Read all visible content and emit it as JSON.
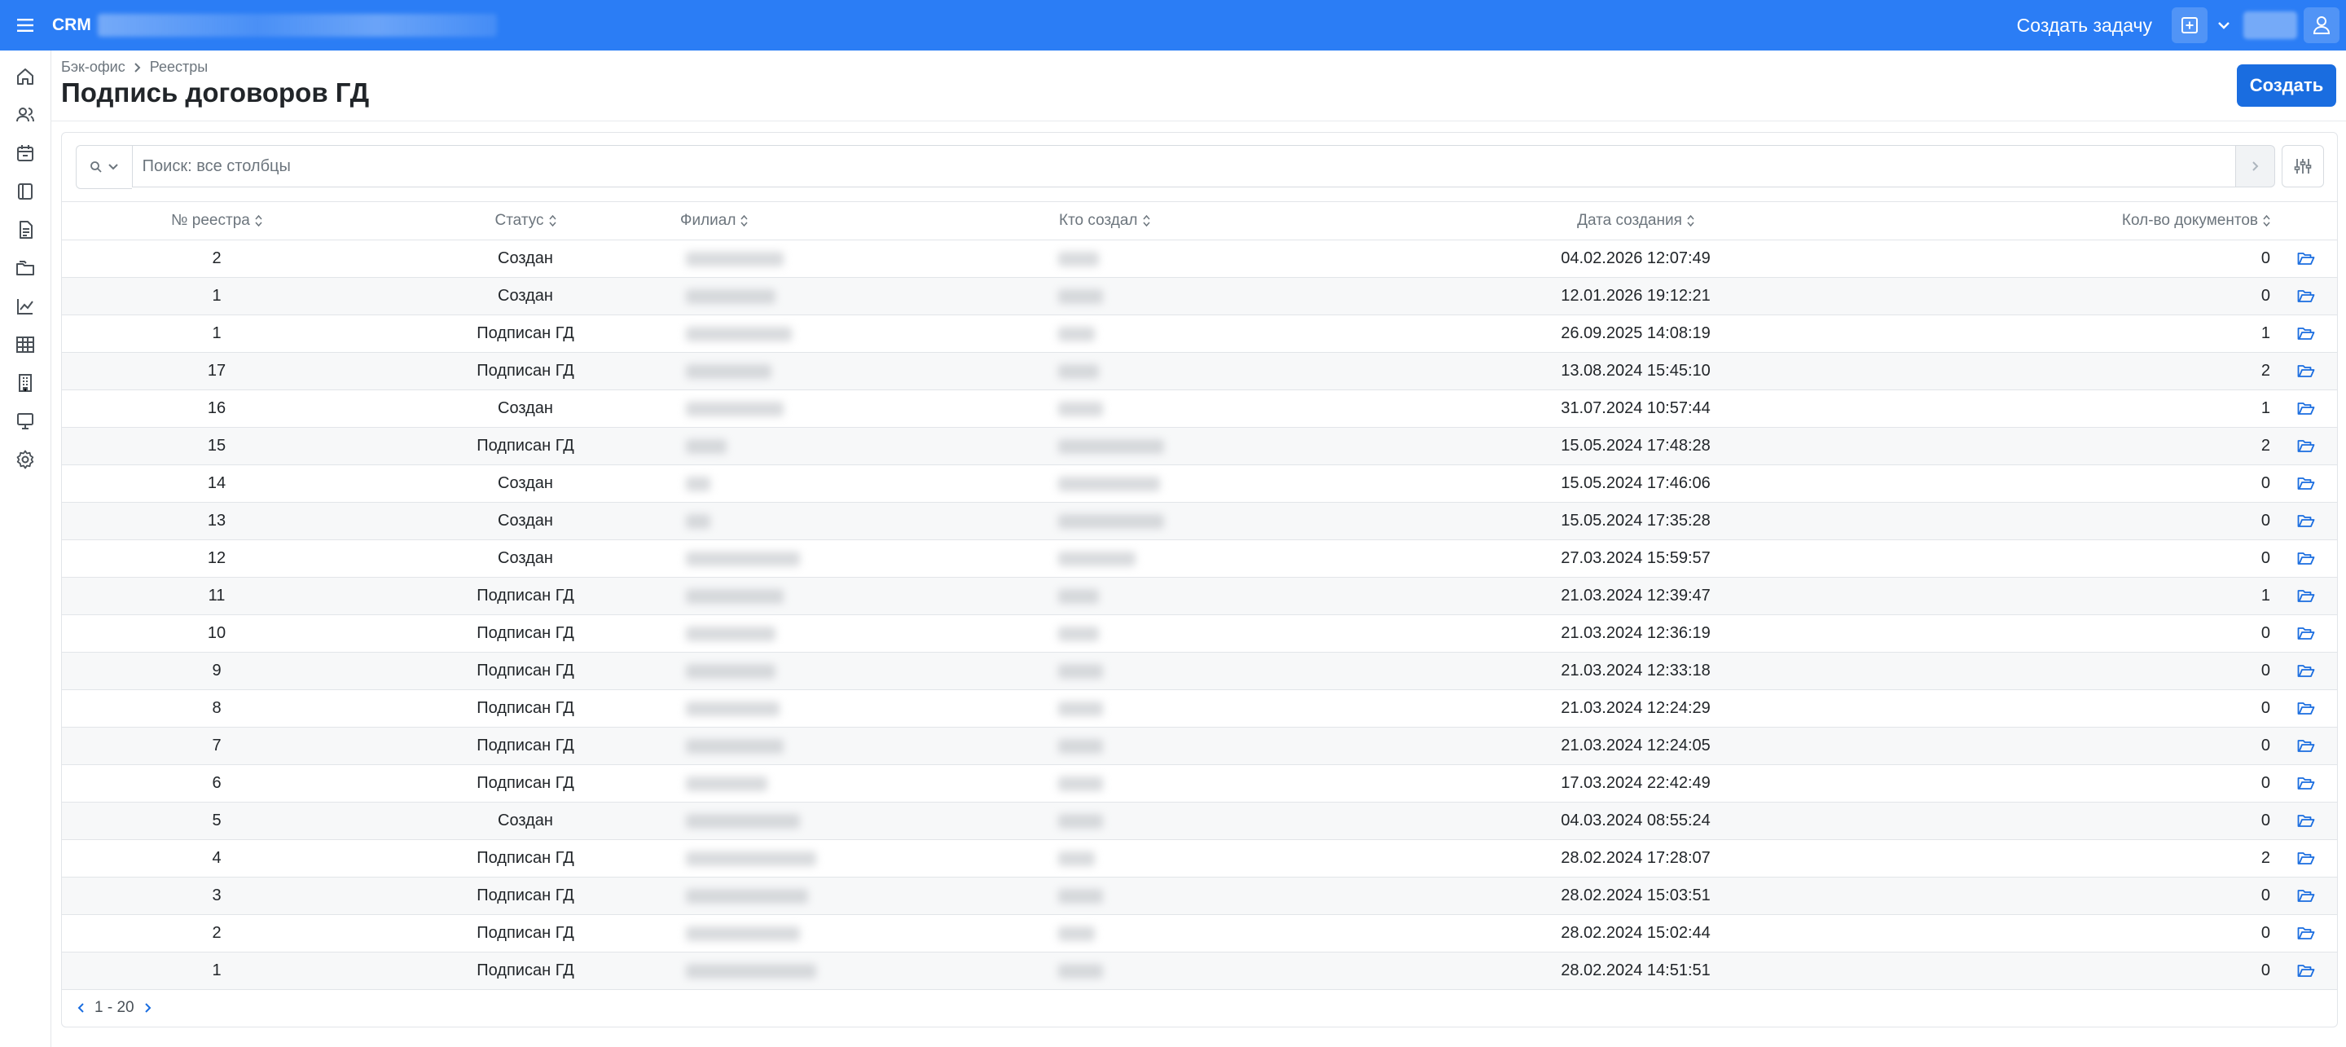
{
  "topbar": {
    "brand": "CRM",
    "create_task_label": "Создать задачу"
  },
  "sidebar": {
    "items": [
      {
        "icon": "home-icon"
      },
      {
        "icon": "users-icon"
      },
      {
        "icon": "calendar-icon"
      },
      {
        "icon": "book-icon"
      },
      {
        "icon": "documents-icon"
      },
      {
        "icon": "folders-icon"
      },
      {
        "icon": "chart-icon"
      },
      {
        "icon": "table-icon"
      },
      {
        "icon": "building-icon"
      },
      {
        "icon": "monitor-icon"
      },
      {
        "icon": "gear-icon"
      }
    ]
  },
  "breadcrumb": {
    "items": [
      "Бэк-офис",
      "Реестры"
    ]
  },
  "page": {
    "title": "Подпись договоров ГД",
    "create_label": "Создать"
  },
  "search": {
    "placeholder": "Поиск: все столбцы"
  },
  "table": {
    "headers": {
      "registry_no": "№ реестра",
      "status": "Статус",
      "branch": "Филиал",
      "created_by": "Кто создал",
      "created_at": "Дата создания",
      "docs_count": "Кол-во документов"
    },
    "rows": [
      {
        "no": "2",
        "status": "Создан",
        "date": "04.02.2026 12:07:49",
        "count": "0"
      },
      {
        "no": "1",
        "status": "Создан",
        "date": "12.01.2026 19:12:21",
        "count": "0"
      },
      {
        "no": "1",
        "status": "Подписан ГД",
        "date": "26.09.2025 14:08:19",
        "count": "1"
      },
      {
        "no": "17",
        "status": "Подписан ГД",
        "date": "13.08.2024 15:45:10",
        "count": "2"
      },
      {
        "no": "16",
        "status": "Создан",
        "date": "31.07.2024 10:57:44",
        "count": "1"
      },
      {
        "no": "15",
        "status": "Подписан ГД",
        "date": "15.05.2024 17:48:28",
        "count": "2"
      },
      {
        "no": "14",
        "status": "Создан",
        "date": "15.05.2024 17:46:06",
        "count": "0"
      },
      {
        "no": "13",
        "status": "Создан",
        "date": "15.05.2024 17:35:28",
        "count": "0"
      },
      {
        "no": "12",
        "status": "Создан",
        "date": "27.03.2024 15:59:57",
        "count": "0"
      },
      {
        "no": "11",
        "status": "Подписан ГД",
        "date": "21.03.2024 12:39:47",
        "count": "1"
      },
      {
        "no": "10",
        "status": "Подписан ГД",
        "date": "21.03.2024 12:36:19",
        "count": "0"
      },
      {
        "no": "9",
        "status": "Подписан ГД",
        "date": "21.03.2024 12:33:18",
        "count": "0"
      },
      {
        "no": "8",
        "status": "Подписан ГД",
        "date": "21.03.2024 12:24:29",
        "count": "0"
      },
      {
        "no": "7",
        "status": "Подписан ГД",
        "date": "21.03.2024 12:24:05",
        "count": "0"
      },
      {
        "no": "6",
        "status": "Подписан ГД",
        "date": "17.03.2024 22:42:49",
        "count": "0"
      },
      {
        "no": "5",
        "status": "Создан",
        "date": "04.03.2024 08:55:24",
        "count": "0"
      },
      {
        "no": "4",
        "status": "Подписан ГД",
        "date": "28.02.2024 17:28:07",
        "count": "2"
      },
      {
        "no": "3",
        "status": "Подписан ГД",
        "date": "28.02.2024 15:03:51",
        "count": "0"
      },
      {
        "no": "2",
        "status": "Подписан ГД",
        "date": "28.02.2024 15:02:44",
        "count": "0"
      },
      {
        "no": "1",
        "status": "Подписан ГД",
        "date": "28.02.2024 14:51:51",
        "count": "0"
      }
    ]
  },
  "pagination": {
    "range": "1 - 20"
  },
  "colors": {
    "accent": "#2b7df5",
    "button": "#1a6de0",
    "folder_icon": "#1a6de0"
  }
}
